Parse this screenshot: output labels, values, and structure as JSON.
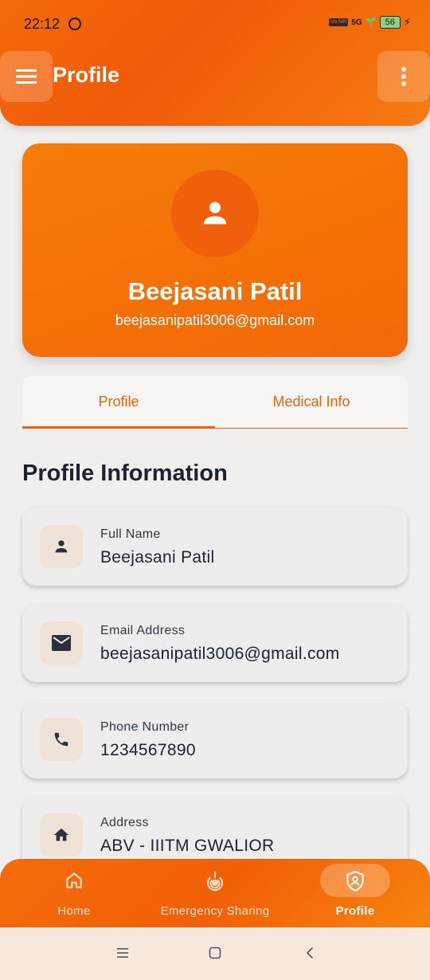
{
  "status_bar": {
    "time": "22:12",
    "network": "5G",
    "volte": "Vo NR",
    "battery": "56"
  },
  "header": {
    "title": "Profile"
  },
  "profile_card": {
    "name": "Beejasani Patil",
    "email": "beejasanipatil3006@gmail.com"
  },
  "tabs": [
    {
      "label": "Profile",
      "active": true
    },
    {
      "label": "Medical Info",
      "active": false
    }
  ],
  "section_title": "Profile Information",
  "info_items": [
    {
      "label": "Full Name",
      "value": "Beejasani Patil",
      "icon": "person-icon"
    },
    {
      "label": "Email Address",
      "value": "beejasanipatil3006@gmail.com",
      "icon": "mail-icon"
    },
    {
      "label": "Phone Number",
      "value": "1234567890",
      "icon": "phone-icon"
    },
    {
      "label": "Address",
      "value": "ABV - IIITM GWALIOR",
      "icon": "home-icon"
    }
  ],
  "bottom_nav": [
    {
      "label": "Home",
      "icon": "home-outline-icon",
      "active": false
    },
    {
      "label": "Emergency Sharing",
      "icon": "emergency-signal-icon",
      "active": false
    },
    {
      "label": "Profile",
      "icon": "shield-user-icon",
      "active": true
    }
  ],
  "colors": {
    "accent": "#f46a0c",
    "background": "#f1efee",
    "text_dark": "#1d2230"
  }
}
